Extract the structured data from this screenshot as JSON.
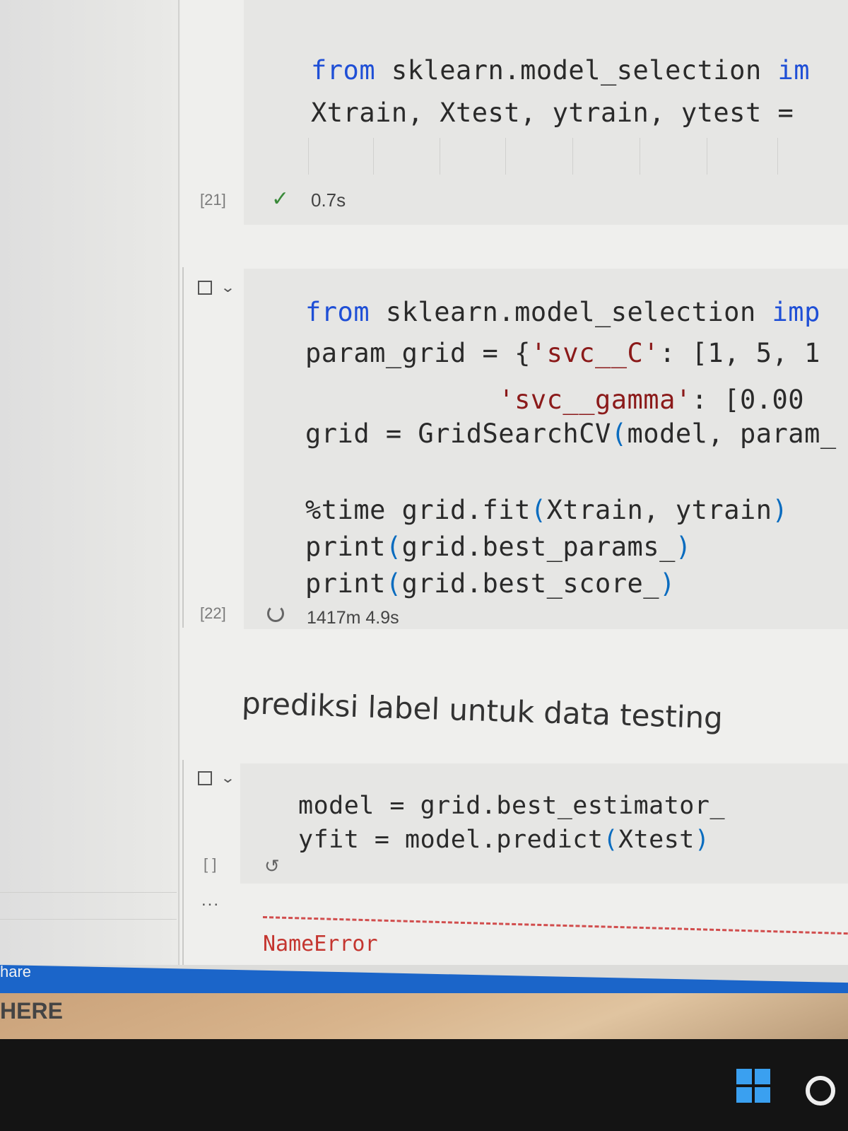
{
  "cells": [
    {
      "exec_count": "[21]",
      "status_icon": "check-icon",
      "duration": "0.7s",
      "lines": [
        {
          "kw": "from",
          "rest": " sklearn.model_selection ",
          "tail": "im"
        },
        {
          "text": "Xtrain, Xtest, ytrain, ytest ="
        }
      ]
    },
    {
      "exec_count": "[22]",
      "status_icon": "running-spinner-icon",
      "duration": "1417m 4.9s",
      "lines": [
        {
          "kw": "from",
          "rest": " sklearn.model_selection ",
          "tail": "imp"
        },
        {
          "pre": "param_grid = {",
          "str": "'svc__C'",
          "post": ": [1, 5, 1"
        },
        {
          "indent": "            ",
          "str": "'svc__gamma'",
          "post": ": [0.00"
        },
        {
          "pre": "grid = GridSearchCV",
          "paren": "(",
          "post": "model, param_"
        },
        {
          "text": ""
        },
        {
          "pre": "%time grid.fit",
          "paren": "(",
          "post": "Xtrain, ytrain",
          "paren2": ")"
        },
        {
          "pre": "print",
          "paren": "(",
          "post": "grid.best_params_",
          "paren2": ")"
        },
        {
          "pre": "print",
          "paren": "(",
          "post": "grid.best_score_",
          "paren2": ")"
        }
      ]
    },
    {
      "markdown": "prediksi label untuk data testing"
    },
    {
      "exec_count": "[ ]",
      "status_icon": "history-icon",
      "lines": [
        {
          "text": "model = grid.best_estimator_"
        },
        {
          "pre": "yfit = model.predict",
          "paren": "(",
          "post": "Xtest",
          "paren2": ")"
        }
      ],
      "output_ellipsis": "...",
      "error_name": "NameError"
    }
  ],
  "statusbar": {
    "left_text": "hare"
  },
  "desk": {
    "left_text": "HERE"
  },
  "colors": {
    "keyword": "#1f4fd6",
    "string": "#8b1a1a",
    "paren": "#0a6cbf",
    "error": "#c4352f",
    "statusbar": "#1b65c9"
  }
}
